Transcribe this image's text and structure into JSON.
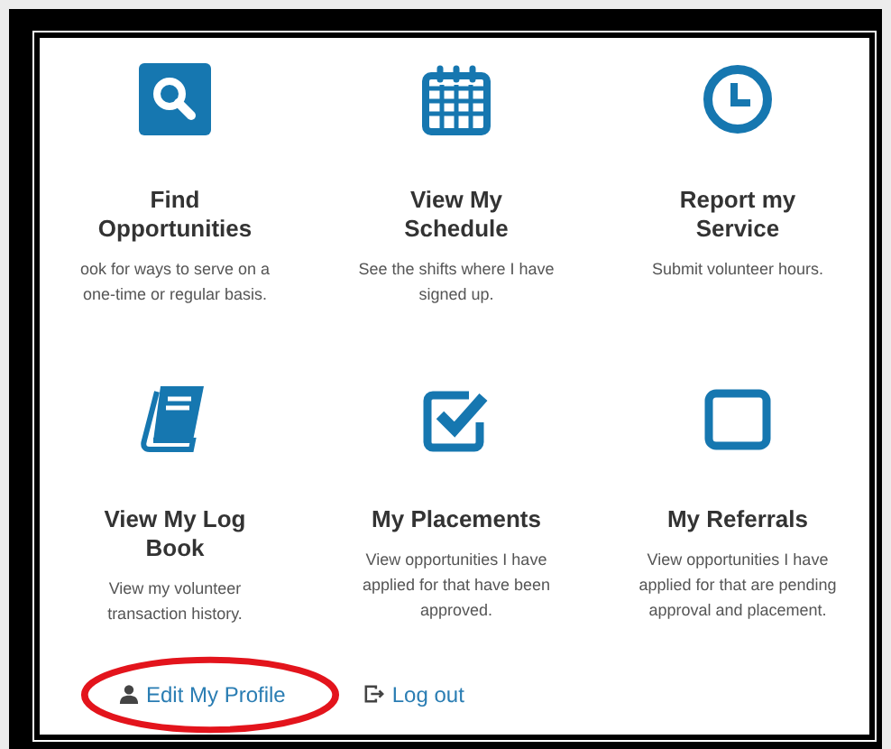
{
  "tiles": [
    {
      "kind": "search",
      "title": "Find Opportunities",
      "description": "ook for ways to serve on a one-time or regular basis."
    },
    {
      "kind": "calendar",
      "title": "View My Schedule",
      "description": "See the shifts where I have signed up."
    },
    {
      "kind": "clock",
      "title": "Report my Service",
      "description": "Submit volunteer hours."
    },
    {
      "kind": "book",
      "title": "View My Log Book",
      "description": "View my volunteer transaction history."
    },
    {
      "kind": "checkbox",
      "title": "My Placements",
      "description": "View opportunities I have applied for that have been approved."
    },
    {
      "kind": "square",
      "title": "My Referrals",
      "description": "View opportunities I have applied for that are pending approval and placement."
    }
  ],
  "links": [
    {
      "kind": "profile",
      "label": "Edit My Profile"
    },
    {
      "kind": "logout",
      "label": "Log out"
    }
  ]
}
